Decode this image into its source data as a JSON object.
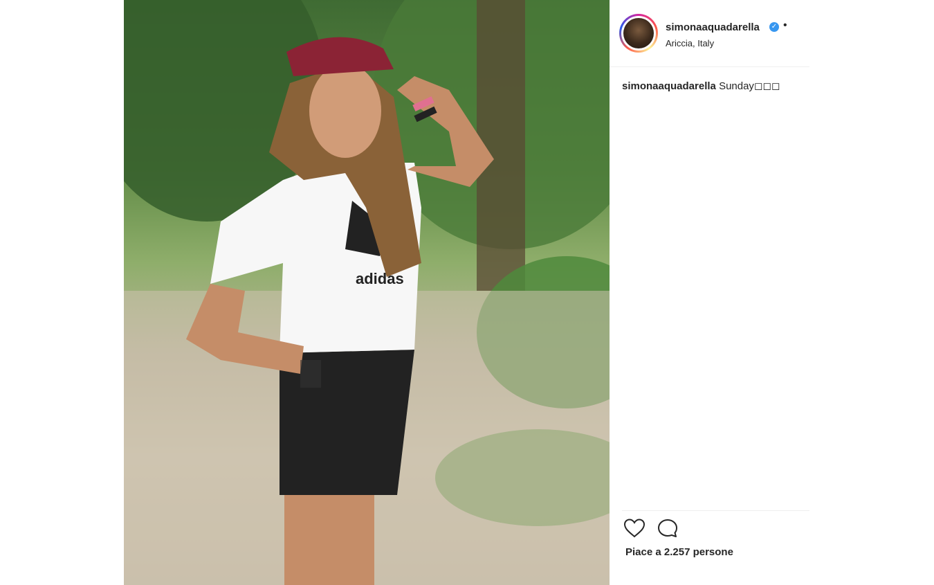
{
  "post": {
    "photo_alt_icon": "post-photo",
    "username": "simonaaquadarella",
    "verified_icon": "verified-badge-icon",
    "separator": "•",
    "location": "Ariccia, Italy",
    "caption": {
      "username": "simonaaquadarella",
      "text": "Sunday◻◻◻"
    },
    "likes_text": "Piace a 2.257 persone"
  },
  "colors": {
    "verified": "#3897f0",
    "text": "#262626",
    "divider": "#efefef"
  }
}
